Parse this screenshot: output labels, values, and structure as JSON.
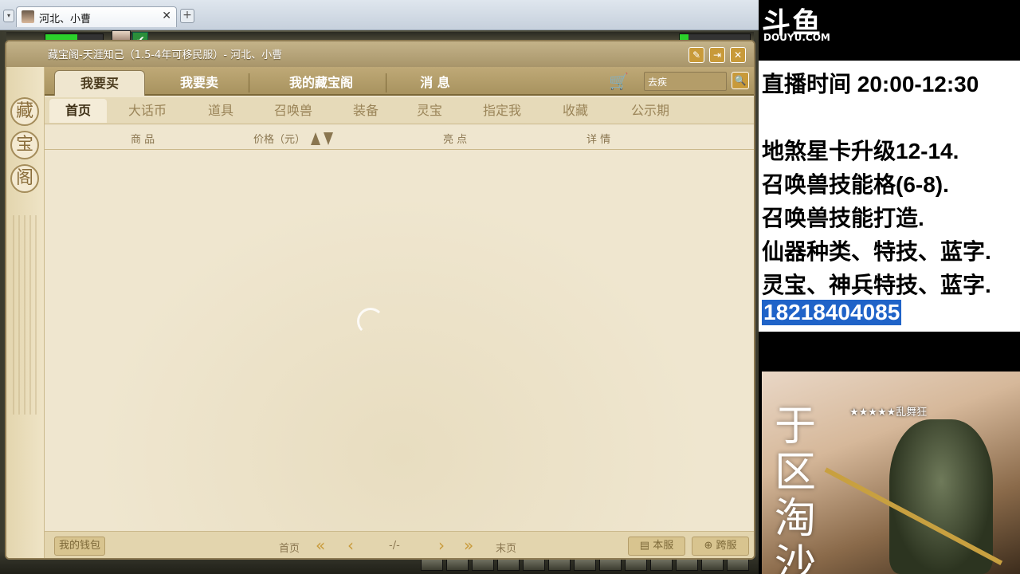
{
  "browser": {
    "tab_title": "河北、小曹",
    "tab_close": "✕",
    "tab_add": "+",
    "tab_dropdown": "▾"
  },
  "game": {
    "check_mark": "✔"
  },
  "window": {
    "title": "藏宝阁-天涯知己（1.5-4年可移民服）- 河北、小曹",
    "edit_glyph": "✎",
    "exit_glyph": "⇥",
    "close_glyph": "✕",
    "rail_seals": [
      "藏",
      "宝",
      "阁"
    ],
    "main_tabs": [
      "我要买",
      "我要卖",
      "我的藏宝阁",
      "消 息"
    ],
    "cart_glyph": "🛒",
    "search_value": "去疾",
    "search_glyph": "🔍",
    "sub_tabs": [
      "首页",
      "大话币",
      "道具",
      "召唤兽",
      "装备",
      "灵宝",
      "指定我",
      "收藏",
      "公示期"
    ],
    "columns": {
      "goods": "商 品",
      "price": "价格（元）",
      "highlight": "亮 点",
      "detail": "详 情"
    },
    "footer": {
      "wallet": "我的钱包",
      "first": "首页",
      "page_indicator": "-/-",
      "last": "末页",
      "this_server": "本服",
      "cross_server": "跨服",
      "first_arrow": "«",
      "prev_arrow": "‹",
      "next_arrow": "›",
      "last_arrow": "»"
    }
  },
  "stream_panel": {
    "logo_text": "斗鱼",
    "logo_url": "DOUYU.COM",
    "lines": [
      "直播时间 20:00-12:30",
      "地煞星卡升级12-14.",
      "召唤兽技能格(6-8).",
      "召唤兽技能打造.",
      "仙器种类、特技、蓝字.",
      "灵宝、神兵特技、蓝字."
    ],
    "phone": "18218404085",
    "card_calligraphy": "于区淘沙",
    "card_rank": "★★★★★乱舞狂"
  },
  "colors": {
    "accent": "#c89a3a",
    "phone_highlight": "#1f63c8",
    "hp_green": "#2bd12b"
  }
}
